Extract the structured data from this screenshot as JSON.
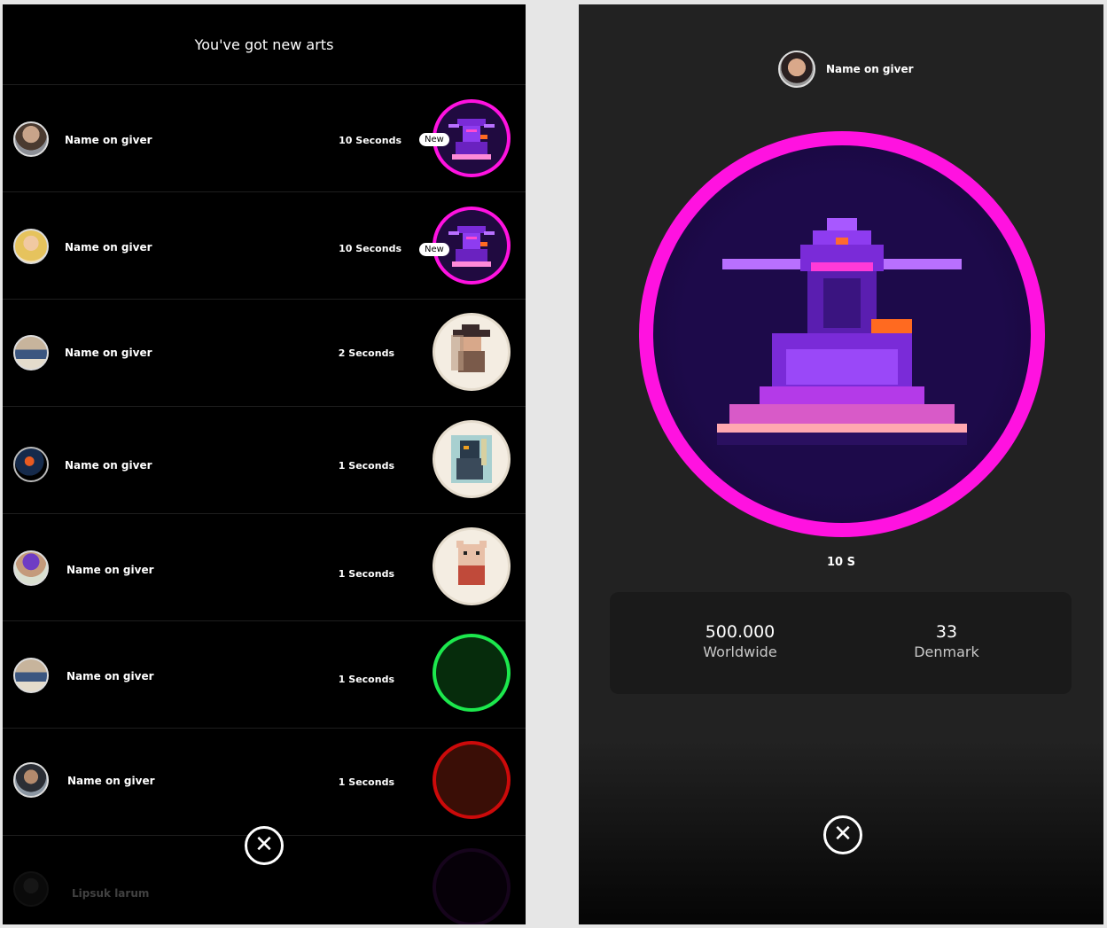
{
  "list_screen": {
    "title": "You've got new arts",
    "new_badge": "New",
    "rows": [
      {
        "name": "Name on giver",
        "time": "10 Seconds",
        "new": true,
        "art": "pink"
      },
      {
        "name": "Name on giver",
        "time": "10 Seconds",
        "new": true,
        "art": "pink"
      },
      {
        "name": "Name on giver",
        "time": "2 Seconds",
        "new": false,
        "art": "cream"
      },
      {
        "name": "Name on giver",
        "time": "1 Seconds",
        "new": false,
        "art": "cream"
      },
      {
        "name": "Name on giver",
        "time": "1 Seconds",
        "new": false,
        "art": "cream"
      },
      {
        "name": "Name on giver",
        "time": "1 Seconds",
        "new": false,
        "art": "green"
      },
      {
        "name": "Name on giver",
        "time": "1 Seconds",
        "new": false,
        "art": "red"
      },
      {
        "name": "Lipsuk larum",
        "time": "",
        "new": false,
        "art": "purple"
      }
    ],
    "close_icon": "close-circle-icon"
  },
  "detail_screen": {
    "giver_name": "Name on giver",
    "duration": "10 S",
    "stats": {
      "worldwide_value": "500.000",
      "worldwide_label": "Worldwide",
      "country_value": "33",
      "country_label": "Denmark"
    },
    "close_icon": "close-circle-icon"
  },
  "colors": {
    "accent_pink": "#ff12e0",
    "green_ring": "#1ce84d",
    "red_ring": "#cc0a0a"
  }
}
